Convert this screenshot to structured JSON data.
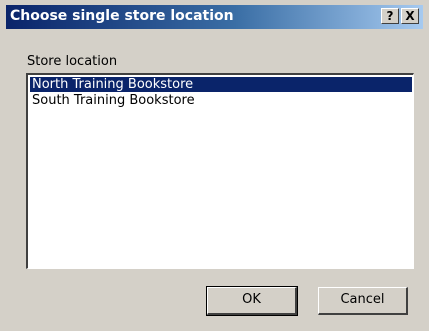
{
  "window": {
    "title": "Choose single store location",
    "help_label": "?",
    "close_label": "X"
  },
  "store_location": {
    "label": "Store location",
    "items": [
      {
        "label": "North Training Bookstore",
        "selected": true
      },
      {
        "label": "South Training Bookstore",
        "selected": false
      }
    ]
  },
  "buttons": {
    "ok_label": "OK",
    "cancel_label": "Cancel"
  },
  "colors": {
    "title_bar": "#0a246a",
    "selection": "#0a246a",
    "dialog_bg": "#d4d0c8"
  }
}
